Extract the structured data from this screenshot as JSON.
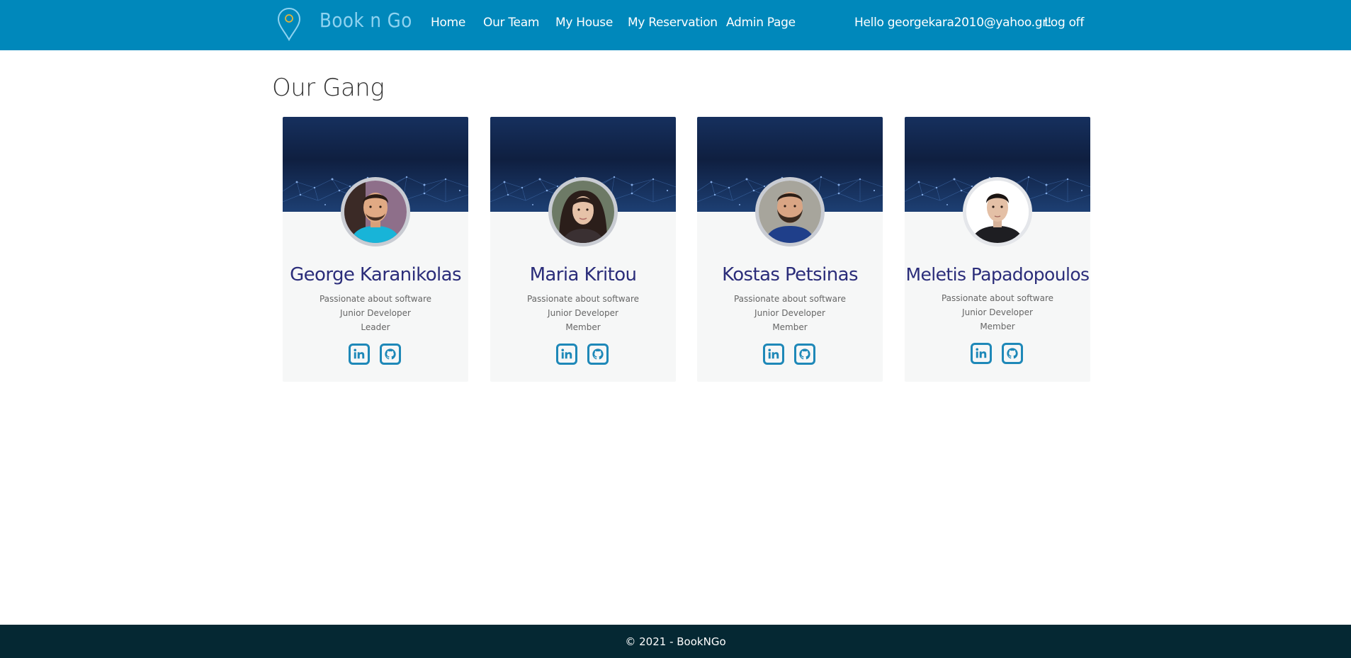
{
  "navbar": {
    "brand": "Book n Go",
    "links": [
      "Home",
      "Our Team",
      "My House",
      "My Reservation",
      "Admin Page"
    ],
    "greeting": "Hello georgekara2010@yahoo.gr!",
    "logoff": "Log off",
    "background_color": "#0088bb"
  },
  "page": {
    "title": "Our Gang"
  },
  "members": [
    {
      "name": "George Karanikolas",
      "tagline": "Passionate about software",
      "role": "Junior Developer",
      "position": "Leader",
      "socials": [
        "linkedin-icon",
        "github-icon"
      ]
    },
    {
      "name": "Maria Kritou",
      "tagline": "Passionate about software",
      "role": "Junior Developer",
      "position": "Member",
      "socials": [
        "linkedin-icon",
        "github-icon"
      ]
    },
    {
      "name": "Kostas Petsinas",
      "tagline": "Passionate about software",
      "role": "Junior Developer",
      "position": "Member",
      "socials": [
        "linkedin-icon",
        "github-icon"
      ]
    },
    {
      "name": "Meletis Papadopoulos",
      "tagline": "Passionate about software",
      "role": "Junior Developer",
      "position": "Member",
      "socials": [
        "linkedin-icon",
        "github-icon"
      ]
    }
  ],
  "footer": {
    "text": "© 2021 - BookNGo",
    "background_color": "#052833"
  },
  "colors": {
    "accent": "#1e88b8",
    "name_color": "#2b2d7a"
  }
}
